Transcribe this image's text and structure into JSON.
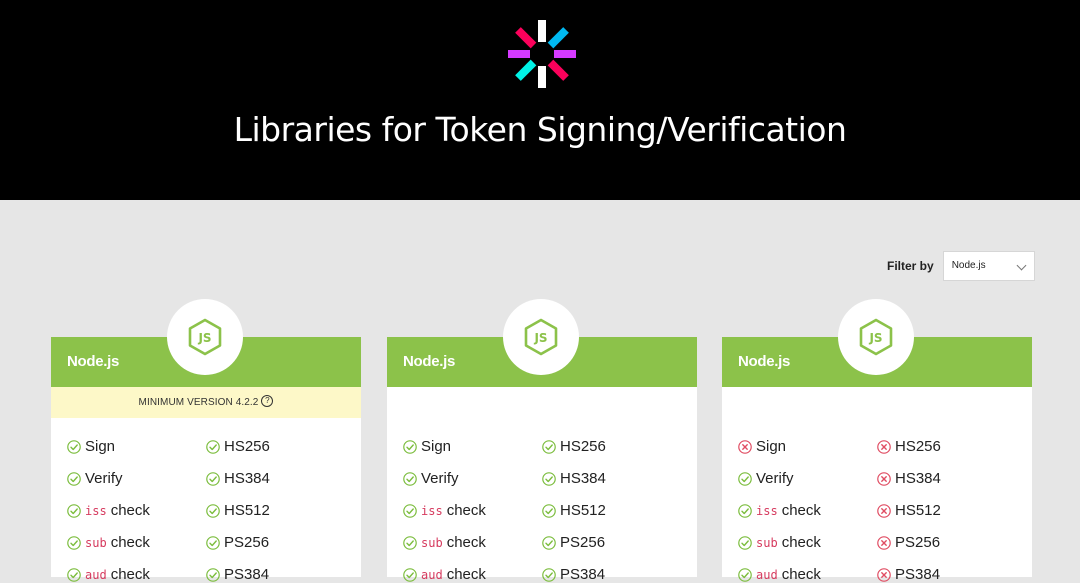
{
  "header": {
    "title": "Libraries for Token Signing/Verification",
    "logo": "jwt-logo"
  },
  "filter": {
    "label": "Filter by",
    "value": "Node.js"
  },
  "colors": {
    "accent": "#8cc24a",
    "check": "#7cbd3e",
    "cross": "#e04d63",
    "code": "#d63a5e",
    "minver_bg": "#fdf8c8"
  },
  "cards": [
    {
      "name": "Node.js",
      "icon": "nodejs-icon",
      "min_version": "MINIMUM VERSION 4.2.2",
      "left": [
        {
          "code": "",
          "label": "Sign",
          "ok": true
        },
        {
          "code": "",
          "label": "Verify",
          "ok": true
        },
        {
          "code": "iss",
          "label": "check",
          "ok": true
        },
        {
          "code": "sub",
          "label": "check",
          "ok": true
        },
        {
          "code": "aud",
          "label": "check",
          "ok": true
        }
      ],
      "right": [
        {
          "label": "HS256",
          "ok": true
        },
        {
          "label": "HS384",
          "ok": true
        },
        {
          "label": "HS512",
          "ok": true
        },
        {
          "label": "PS256",
          "ok": true
        },
        {
          "label": "PS384",
          "ok": true
        }
      ]
    },
    {
      "name": "Node.js",
      "icon": "nodejs-icon",
      "min_version": "",
      "left": [
        {
          "code": "",
          "label": "Sign",
          "ok": true
        },
        {
          "code": "",
          "label": "Verify",
          "ok": true
        },
        {
          "code": "iss",
          "label": "check",
          "ok": true
        },
        {
          "code": "sub",
          "label": "check",
          "ok": true
        },
        {
          "code": "aud",
          "label": "check",
          "ok": true
        }
      ],
      "right": [
        {
          "label": "HS256",
          "ok": true
        },
        {
          "label": "HS384",
          "ok": true
        },
        {
          "label": "HS512",
          "ok": true
        },
        {
          "label": "PS256",
          "ok": true
        },
        {
          "label": "PS384",
          "ok": true
        }
      ]
    },
    {
      "name": "Node.js",
      "icon": "nodejs-icon",
      "min_version": "",
      "left": [
        {
          "code": "",
          "label": "Sign",
          "ok": false
        },
        {
          "code": "",
          "label": "Verify",
          "ok": true
        },
        {
          "code": "iss",
          "label": "check",
          "ok": true
        },
        {
          "code": "sub",
          "label": "check",
          "ok": true
        },
        {
          "code": "aud",
          "label": "check",
          "ok": true
        }
      ],
      "right": [
        {
          "label": "HS256",
          "ok": false
        },
        {
          "label": "HS384",
          "ok": false
        },
        {
          "label": "HS512",
          "ok": false
        },
        {
          "label": "PS256",
          "ok": false
        },
        {
          "label": "PS384",
          "ok": false
        }
      ]
    }
  ]
}
